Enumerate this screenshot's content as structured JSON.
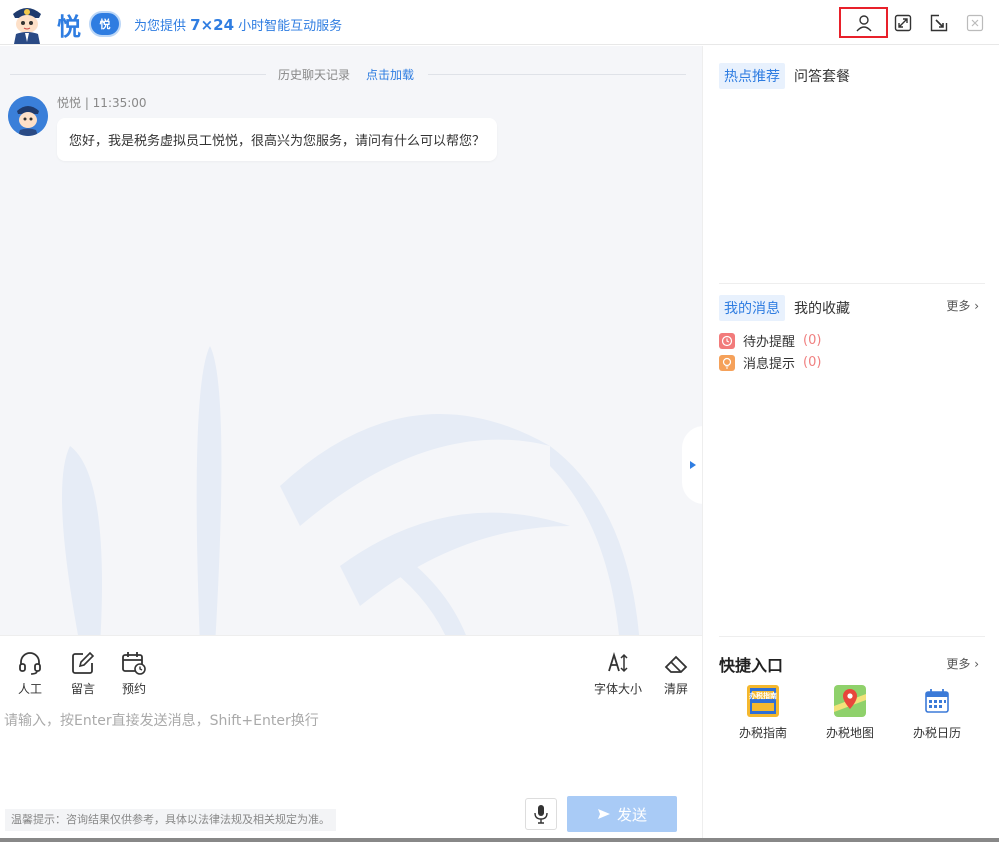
{
  "header": {
    "brand_char": "悦",
    "badge": "悦",
    "tagline_pre": "为您提供 ",
    "tagline_bold": "7×24",
    "tagline_post": " 小时智能互动服务"
  },
  "chat": {
    "history_label": "历史聊天记录",
    "load_label": "点击加载",
    "sender": "悦悦 | 11:35:00",
    "message": "您好，我是税务虚拟员工悦悦，很高兴为您服务，请问有什么可以帮您？"
  },
  "toolbar": {
    "human": "人工",
    "leave_msg": "留言",
    "appoint": "预约",
    "font_size": "字体大小",
    "clear": "清屏"
  },
  "input": {
    "placeholder": "请输入，按Enter直接发送消息，Shift+Enter换行",
    "tip": "温馨提示：咨询结果仅供参考，具体以法律法规及相关规定为准。",
    "send": "发送"
  },
  "right": {
    "tabs1": [
      "热点推荐",
      "问答套餐"
    ],
    "tabs2": [
      "我的消息",
      "我的收藏"
    ],
    "more": "更多",
    "todo_label": "待办提醒",
    "todo_count": "(0)",
    "notice_label": "消息提示",
    "notice_count": "(0)",
    "quick_title": "快捷入口",
    "quick_more": "更多",
    "quick": [
      "办税指南",
      "办税地图",
      "办税日历"
    ],
    "guide_icon_text": "办税指南"
  },
  "colors": {
    "accent": "#2f7de1",
    "highlight": "#e8202a",
    "send_disabled": "#a9cbf6"
  }
}
